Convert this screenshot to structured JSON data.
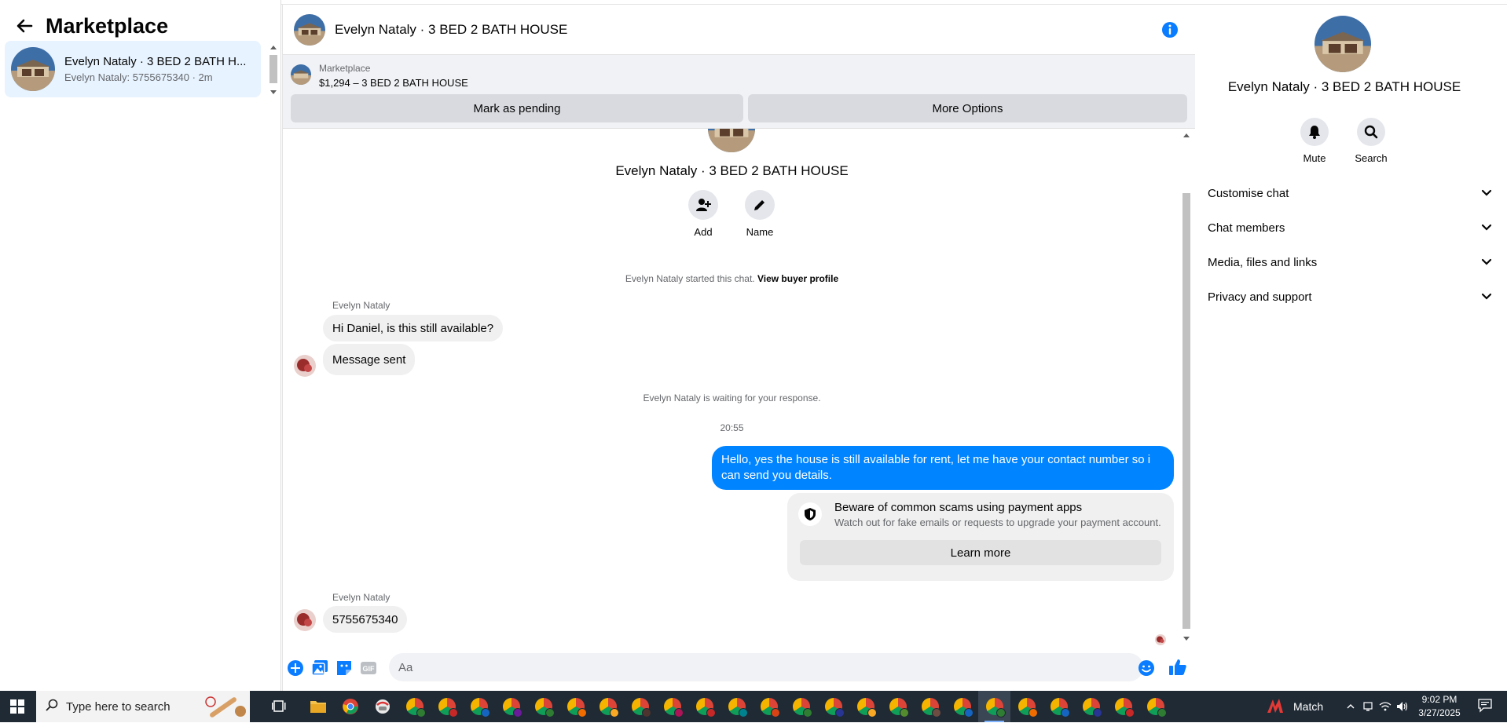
{
  "sidebar": {
    "title": "Marketplace",
    "conversation": {
      "name": "Evelyn Nataly · 3 BED 2 BATH H...",
      "preview": "Evelyn Nataly: 5755675340 · 2m"
    }
  },
  "chat": {
    "title": "Evelyn Nataly · 3 BED 2 BATH HOUSE",
    "listing": {
      "source": "Marketplace",
      "price_title": "$1,294 – 3 BED 2 BATH HOUSE",
      "mark_pending": "Mark as pending",
      "more_options": "More Options"
    },
    "intro": {
      "name": "Evelyn Nataly · 3 BED 2 BATH HOUSE",
      "add_label": "Add",
      "name_label": "Name"
    },
    "started": {
      "text": "Evelyn Nataly started this chat.",
      "link": "View buyer profile"
    },
    "msg1_sender": "Evelyn Nataly",
    "msg1": "Hi Daniel, is this still available?",
    "msg2": "Message sent",
    "waiting": "Evelyn Nataly is waiting for your response.",
    "time": "20:55",
    "outgoing": "Hello, yes the house is still available for rent, let me have your contact number so i can send you details.",
    "warning": {
      "title": "Beware of common scams using payment apps",
      "subtitle": "Watch out for fake emails or requests to upgrade your payment account.",
      "button": "Learn more"
    },
    "msg3_sender": "Evelyn Nataly",
    "msg3": "5755675340",
    "composer_placeholder": "Aa"
  },
  "info_panel": {
    "name": "Evelyn Nataly · 3 BED 2 BATH HOUSE",
    "mute_label": "Mute",
    "search_label": "Search",
    "rows": [
      "Customise chat",
      "Chat members",
      "Media, files and links",
      "Privacy and support"
    ]
  },
  "taskbar": {
    "search_placeholder": "Type here to search",
    "match_label": "Match",
    "time": "9:02 PM",
    "date": "3/27/2025"
  },
  "colors": {
    "messenger_blue": "#0084ff",
    "selected_bg": "#e7f3ff",
    "bubble_gray": "#f0f0f0"
  }
}
